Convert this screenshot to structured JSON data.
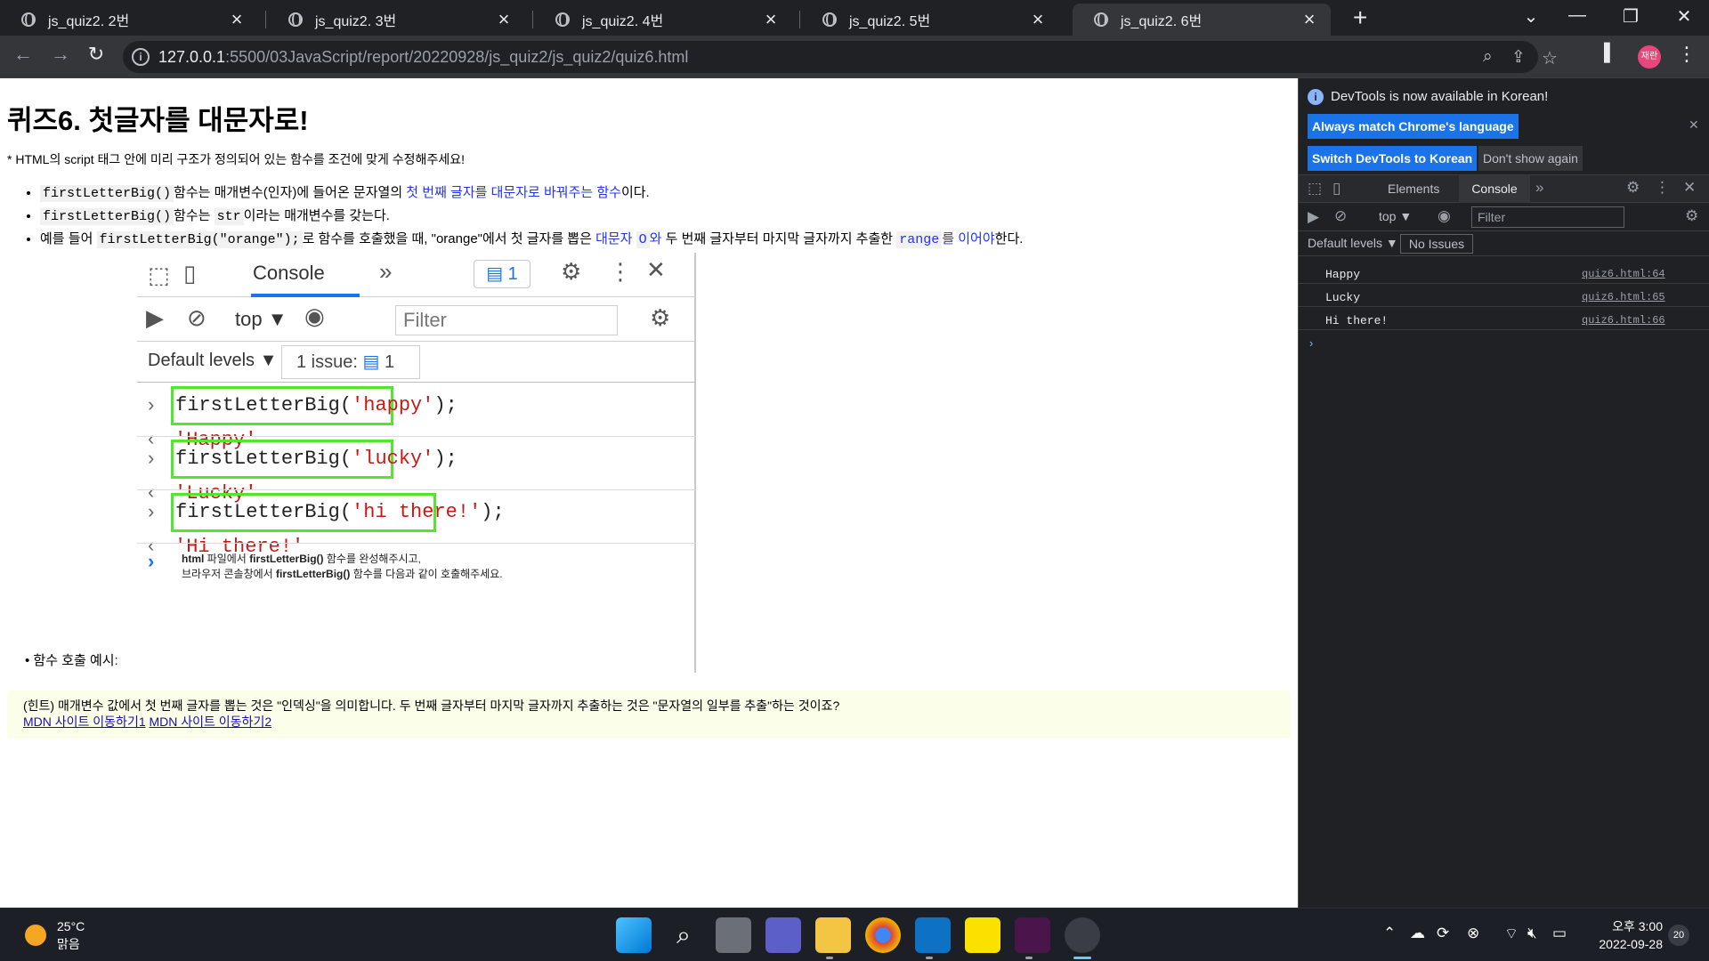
{
  "browser": {
    "tabs": [
      {
        "title": "js_quiz2. 2번"
      },
      {
        "title": "js_quiz2. 3번"
      },
      {
        "title": "js_quiz2. 4번"
      },
      {
        "title": "js_quiz2. 5번"
      },
      {
        "title": "js_quiz2. 6번",
        "active": true
      }
    ],
    "url_host": "127.0.0.1",
    "url_path": ":5500/03JavaScript/report/20220928/js_quiz2/js_quiz2/quiz6.html",
    "profile_label": "재란"
  },
  "page": {
    "title": "퀴즈6. 첫글자를 대문자로!",
    "intro": "* HTML의 script 태그 안에 미리 구조가 정의되어 있는 함수를 조건에 맞게 수정해주세요!",
    "bullet1": {
      "code": "firstLetterBig()",
      "t1": "함수는 매개변수(인자)에 들어온 문자열의 ",
      "blue": "첫 번째 글자를 대문자로 바꿔주는 함수",
      "t2": "이다."
    },
    "bullet2": {
      "code": "firstLetterBig()",
      "t1": "함수는 ",
      "code2": "str",
      "t2": "이라는 매개변수를 갖는다."
    },
    "bullet3": {
      "t1": "예를 들어 ",
      "code": "firstLetterBig(\"orange\");",
      "t2": "로 함수를 호출했을 때, \"orange\"에서 첫 글자를 뽑은 ",
      "blue1": "대문자 ",
      "code_blue1": "O",
      "t3": "와",
      "t4": " 두 번째 글자부터 마지막 글자까지 추출한 ",
      "code_blue2": "range",
      "blue2": "를 이어야",
      "t5": "한다."
    },
    "example_label": "함수 호출 예시:",
    "hint_text": "(힌트) 매개변수 값에서 첫 번째 글자를 뽑는 것은 \"인덱싱\"을 의미합니다. 두 번째 글자부터 마지막 글자까지 추출하는 것은 \"문자열의 일부를 추출\"하는 것이죠?",
    "hint_links": [
      "MDN 사이트 이동하기1",
      "MDN 사이트 이동하기2"
    ]
  },
  "screenshot": {
    "console_tab": "Console",
    "issue_badge": "1",
    "top_label": "top ▼",
    "filter_placeholder": "Filter",
    "levels_label": "Default levels ▼",
    "issue_label": "1 issue:",
    "issue_count": "1",
    "calls": [
      {
        "fn": "firstLetterBig(",
        "arg": "'happy'",
        "end": ");",
        "result": "'Happy'"
      },
      {
        "fn": "firstLetterBig(",
        "arg": "'lucky'",
        "end": ");",
        "result": "'Lucky'"
      },
      {
        "fn": "firstLetterBig(",
        "arg": "'hi there!'",
        "end": ");",
        "result": "'Hi there!'"
      }
    ],
    "note": {
      "l1a": "html",
      "l1b": " 파일에서 ",
      "l1c": "firstLetterBig()",
      "l1d": " 함수를 완성해주시고,",
      "l2a": "브라우저 콘솔창에서 ",
      "l2b": "firstLetterBig()",
      "l2c": " 함수를 다음과 같이 호출해주세요."
    }
  },
  "devtools": {
    "banner_text": "DevTools is now available in Korean!",
    "btn_match": "Always match Chrome's language",
    "btn_switch": "Switch DevTools to Korean",
    "btn_dont": "Don't show again",
    "tab_elements": "Elements",
    "tab_console": "Console",
    "context": "top ▼",
    "filter_placeholder": "Filter",
    "levels": "Default levels ▼",
    "issues": "No Issues",
    "logs": [
      {
        "msg": "Happy",
        "src": "quiz6.html:64"
      },
      {
        "msg": "Lucky",
        "src": "quiz6.html:65"
      },
      {
        "msg": "Hi there!",
        "src": "quiz6.html:66"
      }
    ]
  },
  "taskbar": {
    "temp": "25°C",
    "weather": "맑음",
    "time": "오후 3:00",
    "date": "2022-09-28",
    "notifications": "20"
  },
  "colors": {
    "highlight_box": "#52e62c",
    "link_blue": "#2233ee",
    "hint_bg": "#fbfee8"
  }
}
